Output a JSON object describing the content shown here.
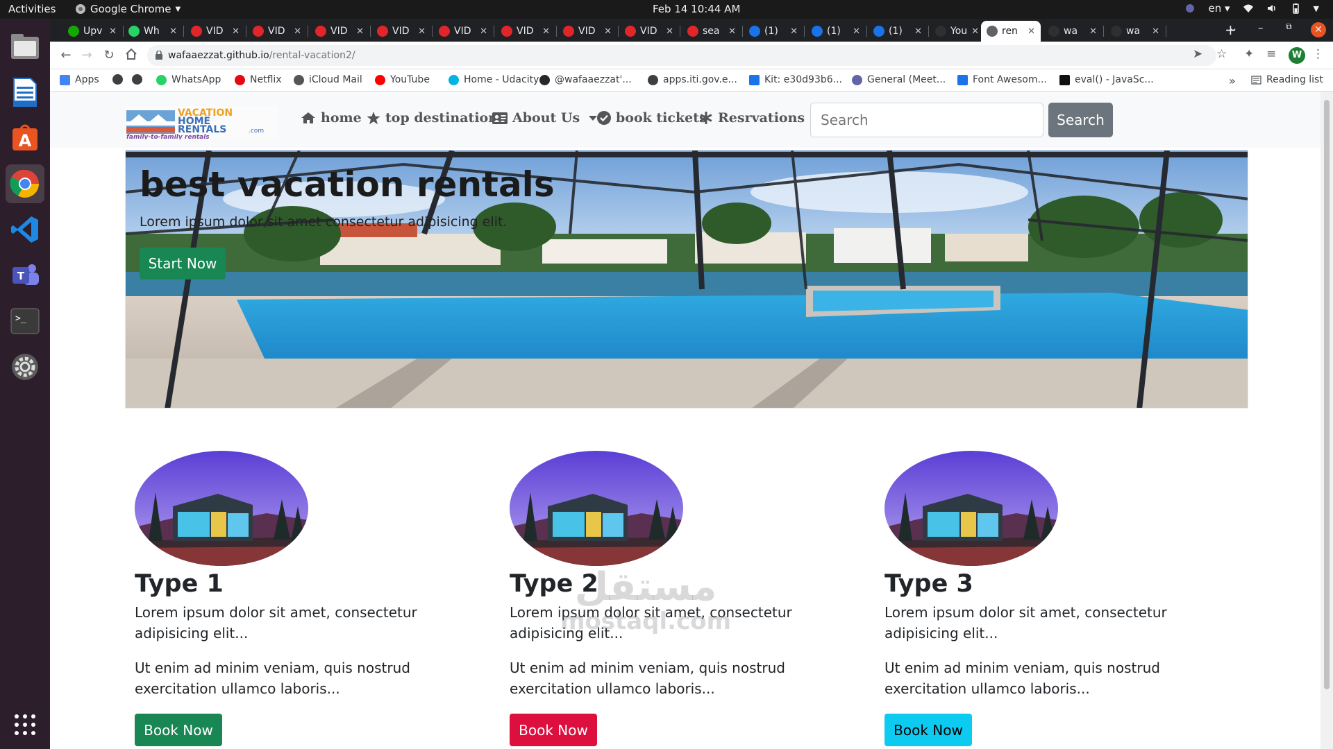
{
  "system_bar": {
    "activities": "Activities",
    "app_name": "Google Chrome",
    "clock": "Feb 14  10:44 AM",
    "language": "en"
  },
  "dock": {
    "items": [
      "files-icon",
      "libreoffice-writer-icon",
      "ubuntu-software-icon",
      "chrome-icon",
      "vscode-icon",
      "teams-icon",
      "terminal-icon",
      "settings-icon",
      "app-grid-icon"
    ]
  },
  "tabs": [
    {
      "label": "Upv",
      "icon": "upwork-icon",
      "color": "#14a800"
    },
    {
      "label": "Wh",
      "icon": "whatsapp-icon",
      "color": "#25d366"
    },
    {
      "label": "VID",
      "icon": "tab-red-icon",
      "color": "#e0262a"
    },
    {
      "label": "VID",
      "icon": "tab-red-icon",
      "color": "#e0262a"
    },
    {
      "label": "VID",
      "icon": "tab-red-icon",
      "color": "#e0262a"
    },
    {
      "label": "VID",
      "icon": "tab-red-icon",
      "color": "#e0262a"
    },
    {
      "label": "VID",
      "icon": "tab-red-icon",
      "color": "#e0262a"
    },
    {
      "label": "VID",
      "icon": "tab-red-icon",
      "color": "#e0262a"
    },
    {
      "label": "VID",
      "icon": "tab-red-icon",
      "color": "#e0262a"
    },
    {
      "label": "VID",
      "icon": "tab-red-icon",
      "color": "#e0262a"
    },
    {
      "label": "sea",
      "icon": "tab-red-icon",
      "color": "#e0262a"
    },
    {
      "label": "(1)",
      "icon": "tab-blue-icon",
      "color": "#1a73e8"
    },
    {
      "label": "(1)",
      "icon": "tab-blue-icon",
      "color": "#1a73e8"
    },
    {
      "label": "(1)",
      "icon": "tab-blue-icon",
      "color": "#1a73e8"
    },
    {
      "label": "You",
      "icon": "github-icon",
      "color": "#2f2f2f"
    },
    {
      "label": "ren",
      "icon": "globe-icon",
      "color": "#5f6368",
      "active": true
    },
    {
      "label": "wa",
      "icon": "github-icon",
      "color": "#2f2f2f"
    },
    {
      "label": "wa",
      "icon": "github-icon",
      "color": "#2f2f2f"
    }
  ],
  "address_bar": {
    "host": "wafaaezzat.github.io",
    "path": "/rental-vacation2/"
  },
  "profile_initial": "W",
  "bookmarks": {
    "items": [
      {
        "label": "Apps",
        "icon": "apps-grid-icon"
      },
      {
        "label": "",
        "icon": "globe-icon"
      },
      {
        "label": "",
        "icon": "globe-icon"
      },
      {
        "label": "WhatsApp",
        "icon": "whatsapp-icon"
      },
      {
        "label": "Netflix",
        "icon": "netflix-icon"
      },
      {
        "label": "iCloud Mail",
        "icon": "apple-icon"
      },
      {
        "label": "YouTube",
        "icon": "youtube-icon"
      },
      {
        "label": "Home - Udacity",
        "icon": "udacity-icon"
      },
      {
        "label": "@wafaaezzat'...",
        "icon": "github-icon"
      },
      {
        "label": "apps.iti.gov.e...",
        "icon": "globe-icon"
      },
      {
        "label": "Kit: e30d93b6...",
        "icon": "flag-icon"
      },
      {
        "label": "General (Meet...",
        "icon": "teams-icon"
      },
      {
        "label": "Font Awesom...",
        "icon": "flag-icon"
      },
      {
        "label": "eval() - JavaSc...",
        "icon": "mdn-icon"
      }
    ],
    "overflow": "»",
    "reading_list": "Reading list"
  },
  "site": {
    "nav": {
      "home": "home",
      "top_destinations": "top destinations",
      "about_us": "About Us",
      "book_tickets": "book tickets",
      "reservations": "Resrvations",
      "search_placeholder": "Search",
      "search_button": "Search"
    },
    "logo": {
      "line1": "VACATION",
      "line2": "HOME",
      "line3": "RENTALS",
      "suffix": ".com",
      "tagline": "family-to-family rentals"
    },
    "hero": {
      "title": "best vacation rentals",
      "text": "Lorem ipsum dolor sit amet consectetur adipisicing elit.",
      "button": "Start Now"
    },
    "cards": [
      {
        "title": "Type 1",
        "text1": "Lorem ipsum dolor sit amet, consectetur adipisicing elit...",
        "text2": "Ut enim ad minim veniam, quis nostrud exercitation ullamco laboris...",
        "button": "Book Now",
        "button_color": "#198754"
      },
      {
        "title": "Type 2",
        "text1": "Lorem ipsum dolor sit amet, consectetur adipisicing elit...",
        "text2": "Ut enim ad minim veniam, quis nostrud exercitation ullamco laboris...",
        "button": "Book Now",
        "button_color": "#dc0f3e"
      },
      {
        "title": "Type 3",
        "text1": "Lorem ipsum dolor sit amet, consectetur adipisicing elit...",
        "text2": "Ut enim ad minim veniam, quis nostrud exercitation ullamco laboris...",
        "button": "Book Now",
        "button_color": "#0dcaf0"
      }
    ]
  },
  "watermark": {
    "arabic": "مستقل",
    "latin": "mostaql.com"
  }
}
